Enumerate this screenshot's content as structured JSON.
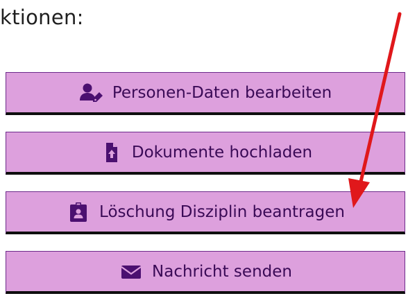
{
  "section": {
    "heading": "ktionen:"
  },
  "actions": [
    {
      "label": "Personen-Daten bearbeiten",
      "icon": "user-edit-icon"
    },
    {
      "label": "Dokumente hochladen",
      "icon": "file-upload-icon"
    },
    {
      "label": "Löschung Disziplin beantragen",
      "icon": "id-badge-icon"
    },
    {
      "label": "Nachricht senden",
      "icon": "envelope-icon"
    }
  ],
  "colors": {
    "button_bg": "#dda0dd",
    "button_text": "#3a0a56",
    "icon": "#4b1070",
    "annotation_arrow": "#e0181b"
  }
}
